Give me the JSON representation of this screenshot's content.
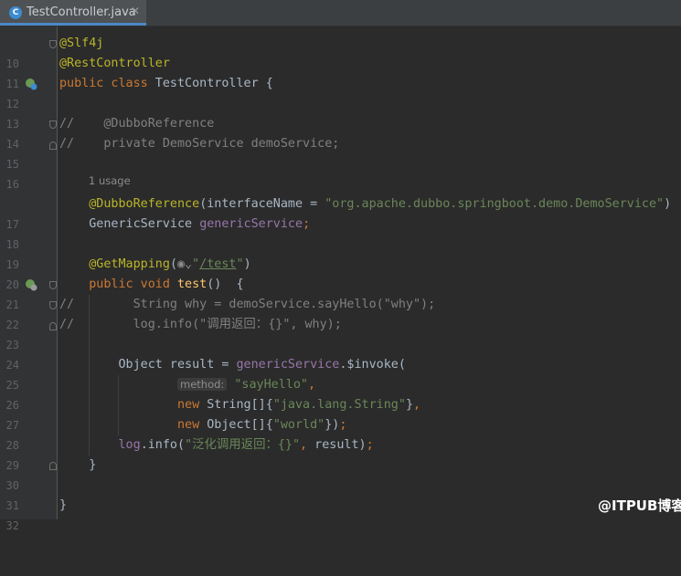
{
  "tab": {
    "title": "TestController.java",
    "icon_letter": "C",
    "close_glyph": "✕"
  },
  "lines": [
    {
      "num": "10",
      "code": "@Slf4j"
    },
    {
      "num": "11",
      "code": "@RestController"
    },
    {
      "num": "12",
      "code": "public class TestController {"
    },
    {
      "num": "13",
      "code": ""
    },
    {
      "num": "14",
      "code": "//    @DubboReference"
    },
    {
      "num": "15",
      "code": "//    private DemoService demoService;"
    },
    {
      "num": "16",
      "code": ""
    },
    {
      "num": "17",
      "code": "    @DubboReference(interfaceName = \"org.apache.dubbo.springboot.demo.DemoService\")"
    },
    {
      "num": "18",
      "code": "    GenericService genericService;"
    },
    {
      "num": "19",
      "code": ""
    },
    {
      "num": "20",
      "code": "    @GetMapping(\"/test\")"
    },
    {
      "num": "21",
      "code": "    public void test()  {"
    },
    {
      "num": "22",
      "code": "//        String why = demoService.sayHello(\"why\");"
    },
    {
      "num": "23",
      "code": "//        log.info(\"调用返回：{}\", why);"
    },
    {
      "num": "24",
      "code": ""
    },
    {
      "num": "25",
      "code": "        Object result = genericService.$invoke("
    },
    {
      "num": "26",
      "code": "                \"sayHello\","
    },
    {
      "num": "27",
      "code": "                new String[]{\"java.lang.String\"},"
    },
    {
      "num": "28",
      "code": "                new Object[]{\"world\"});"
    },
    {
      "num": "29",
      "code": "        log.info(\"泛化调用返回：{}\", result);"
    },
    {
      "num": "30",
      "code": "    }"
    },
    {
      "num": "31",
      "code": ""
    },
    {
      "num": "32",
      "code": "}"
    }
  ],
  "inlays": {
    "usage": "1 usage",
    "param_hint": "method:"
  },
  "watermark": "@ITPUB博客",
  "colors": {
    "keyword": "#cc7832",
    "annotation": "#bbb529",
    "string": "#6a8759",
    "field": "#9876aa",
    "method": "#ffc66d",
    "comment": "#808080",
    "text": "#a9b7c6"
  }
}
